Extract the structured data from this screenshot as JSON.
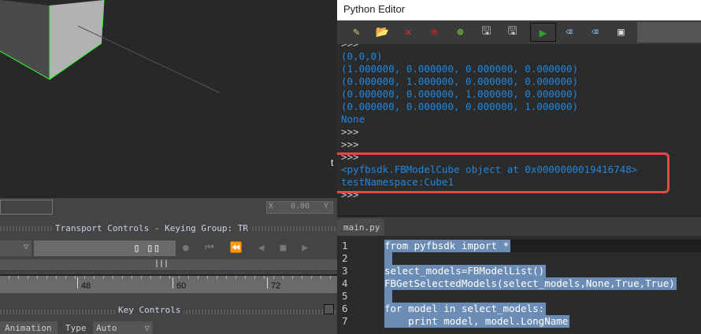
{
  "viewport": {
    "stray_char": "t"
  },
  "transport": {
    "title": "Transport Controls  -  Keying Group: TR",
    "x_label": "X",
    "y_label": "Y",
    "x_value": "0.00",
    "ruler_ticks": [
      "48",
      "60",
      "72"
    ]
  },
  "key_controls": {
    "title": "Key Controls",
    "animation_tab": "Animation",
    "type_label": "Type",
    "type_value": "Auto"
  },
  "editor": {
    "title": "Python Editor",
    "toolbar": [
      "new-script",
      "open",
      "close",
      "close-all",
      "clear",
      "save",
      "save-as",
      "execute",
      "execute-selection",
      "clear-console",
      "run-dialog"
    ],
    "console": [
      ">>>",
      "(0,0,0)",
      "(1.000000, 0.000000, 0.000000, 0.000000)",
      "(0.000000, 1.000000, 0.000000, 0.000000)",
      "(0.000000, 0.000000, 1.000000, 0.000000)",
      "(0.000000, 0.000000, 0.000000, 1.000000)",
      "None",
      ">>>",
      ">>>",
      ">>>",
      "<pyfbsdk.FBModelCube object at 0x0000000019416748>",
      "testNamespace:Cube1",
      ">>>"
    ],
    "tab": "main.py",
    "code": [
      {
        "n": "1",
        "t": "from pyfbsdk import *"
      },
      {
        "n": "2",
        "t": " "
      },
      {
        "n": "3",
        "t": "select_models=FBModelList()"
      },
      {
        "n": "4",
        "t": "FBGetSelectedModels(select_models,None,True,True)"
      },
      {
        "n": "5",
        "t": " "
      },
      {
        "n": "6",
        "t": "for model in select_models:"
      },
      {
        "n": "7",
        "t": "    print model, model.LongName"
      }
    ]
  }
}
